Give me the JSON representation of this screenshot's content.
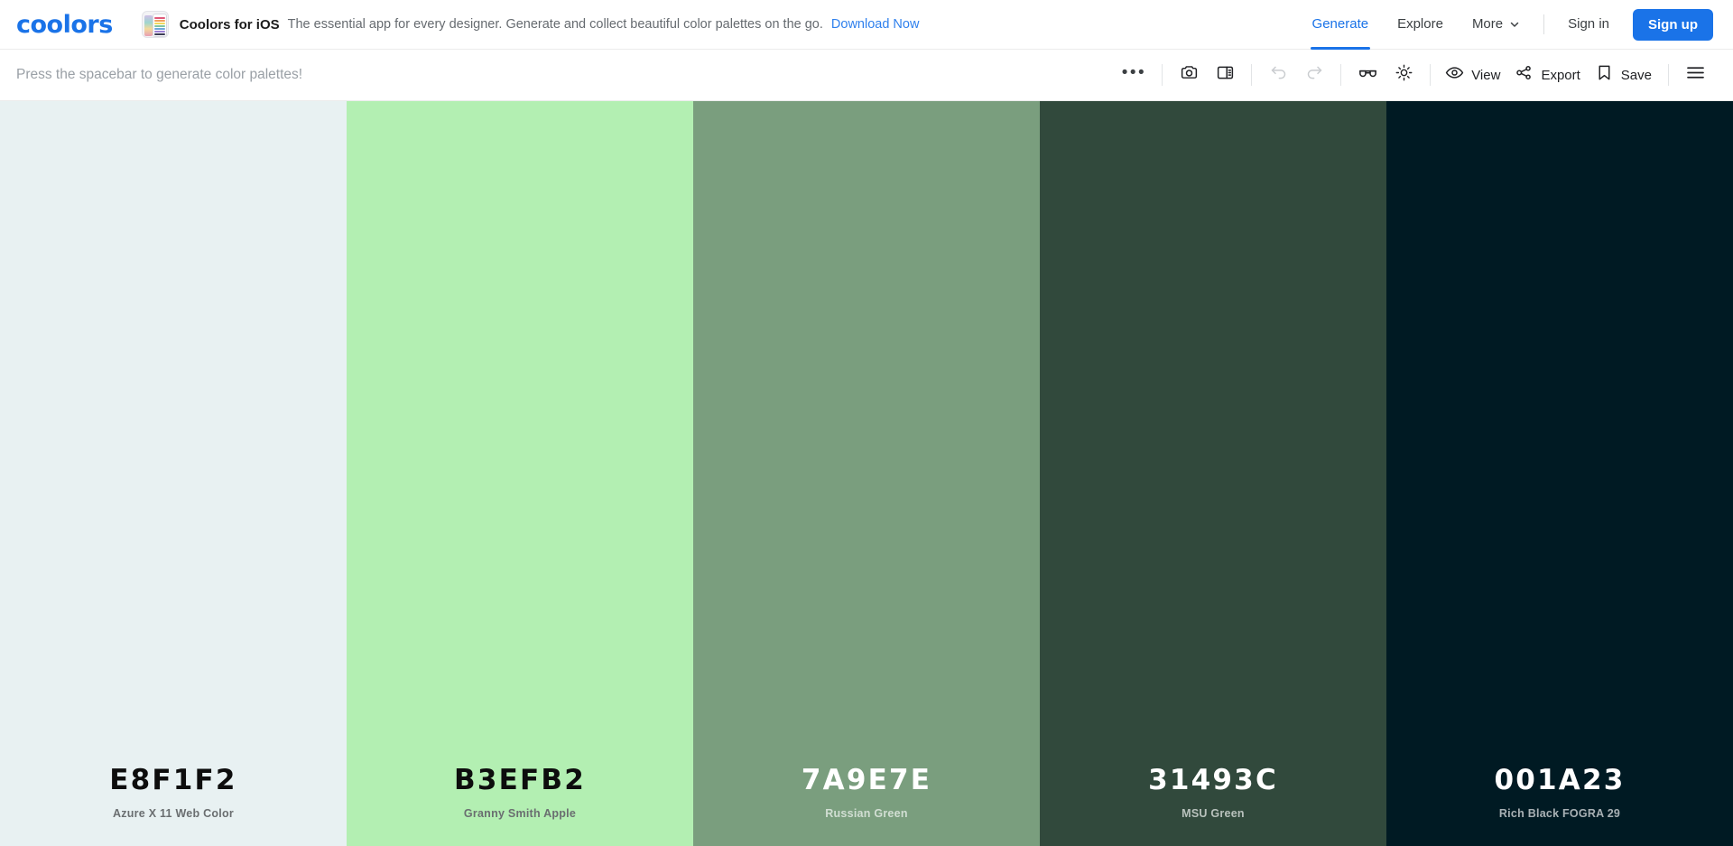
{
  "header": {
    "logo": "coolors",
    "banner": {
      "icon": "ios-app-icon",
      "title": "Coolors for iOS",
      "description": "The essential app for every designer. Generate and collect beautiful color palettes on the go.",
      "link": "Download Now"
    },
    "nav": [
      {
        "label": "Generate",
        "active": true
      },
      {
        "label": "Explore",
        "active": false
      },
      {
        "label": "More",
        "active": false,
        "icon": "chevron-down-icon"
      }
    ],
    "signin_label": "Sign in",
    "signup_label": "Sign up",
    "accent_color": "#1a73e8"
  },
  "toolbar": {
    "hint": "Press the spacebar to generate color palettes!",
    "tools": [
      {
        "name": "more-options",
        "icon": "ellipsis-icon",
        "label": ""
      },
      {
        "name": "camera",
        "icon": "camera-icon",
        "label": ""
      },
      {
        "name": "layout-panel",
        "icon": "panel-layout-icon",
        "label": ""
      },
      {
        "name": "undo",
        "icon": "undo-icon",
        "label": "",
        "disabled": true
      },
      {
        "name": "redo",
        "icon": "redo-icon",
        "label": "",
        "disabled": true
      },
      {
        "name": "color-blindness",
        "icon": "glasses-icon",
        "label": ""
      },
      {
        "name": "adjust",
        "icon": "brightness-icon",
        "label": ""
      },
      {
        "name": "view",
        "icon": "eye-icon",
        "label": "View"
      },
      {
        "name": "export",
        "icon": "share-icon",
        "label": "Export"
      },
      {
        "name": "save",
        "icon": "bookmark-icon",
        "label": "Save"
      },
      {
        "name": "menu",
        "icon": "hamburger-icon",
        "label": ""
      }
    ],
    "view_label": "View",
    "export_label": "Export",
    "save_label": "Save"
  },
  "palette": {
    "swatches": [
      {
        "hex": "E8F1F2",
        "color": "#E8F1F2",
        "name": "Azure X 11 Web Color",
        "text": "dark"
      },
      {
        "hex": "B3EFB2",
        "color": "#B3EFB2",
        "name": "Granny Smith Apple",
        "text": "dark"
      },
      {
        "hex": "7A9E7E",
        "color": "#7A9E7E",
        "name": "Russian Green",
        "text": "light"
      },
      {
        "hex": "31493C",
        "color": "#31493C",
        "name": "MSU Green",
        "text": "light"
      },
      {
        "hex": "001A23",
        "color": "#001A23",
        "name": "Rich Black FOGRA 29",
        "text": "light"
      }
    ]
  }
}
